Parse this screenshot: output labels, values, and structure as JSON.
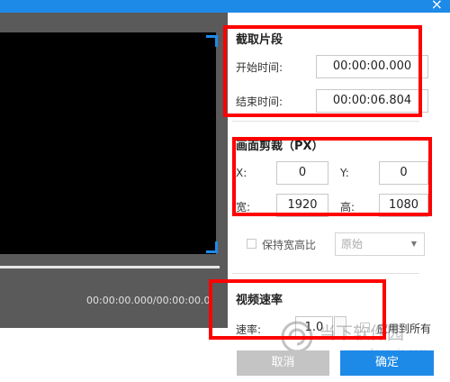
{
  "window": {
    "close_glyph": "×"
  },
  "player": {
    "timecode": "00:00:00.000/00:00:00.0"
  },
  "clip": {
    "title": "截取片段",
    "start_label": "开始时间:",
    "start_value": "00:00:00.000",
    "end_label": "结束时间:",
    "end_value": "00:00:06.804"
  },
  "crop": {
    "title": "画面剪裁（PX）",
    "x_label": "X:",
    "x_value": "0",
    "y_label": "Y:",
    "y_value": "0",
    "w_label": "宽:",
    "w_value": "1920",
    "h_label": "高:",
    "h_value": "1080",
    "keep_ratio_label": "保持宽高比",
    "ratio_select": "原始"
  },
  "speed": {
    "title": "视频速率",
    "rate_label": "速率:",
    "rate_value": "1.0",
    "apply_all_label": "应用到所有"
  },
  "buttons": {
    "cancel": "取消",
    "ok": "确定"
  },
  "watermark": {
    "text": "当下软件园",
    "url": "www.downxia.com"
  },
  "colors": {
    "accent": "#1e8ae8",
    "highlight": "#ff0000"
  }
}
